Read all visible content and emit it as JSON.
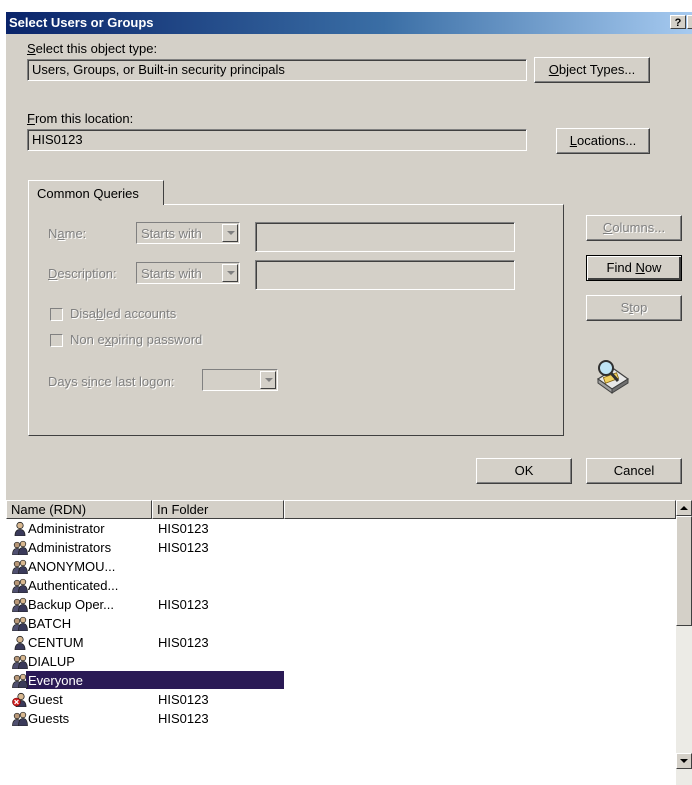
{
  "window": {
    "title": "Select Users or Groups",
    "help_glyph": "?",
    "close_glyph": "×"
  },
  "object_type": {
    "label_key": "S",
    "label_rest": "elect this object type:",
    "value": "Users, Groups, or Built-in security principals",
    "button_key": "O",
    "button_rest": "bject Types..."
  },
  "location": {
    "label_key": "F",
    "label_rest": "rom this location:",
    "value": "HIS0123",
    "button_key": "L",
    "button_rest": "ocations..."
  },
  "tab": {
    "label": "Common Queries"
  },
  "queries": {
    "name_label_a": "N",
    "name_label_key": "a",
    "name_label_b": "me:",
    "name_mode": "Starts with",
    "description_label_key": "D",
    "description_label_rest": "escription:",
    "description_mode": "Starts with",
    "disabled_a": "Disa",
    "disabled_key": "b",
    "disabled_b": "led accounts",
    "nonexpiring_a": "Non e",
    "nonexpiring_key": "x",
    "nonexpiring_b": "piring password",
    "days_a": "Days s",
    "days_key": "i",
    "days_b": "nce last logon:",
    "days_value": ""
  },
  "side_buttons": {
    "columns_key": "C",
    "columns_rest": "olumns...",
    "findnow_a": "Find ",
    "findnow_key": "N",
    "findnow_b": "ow",
    "stop_a": "S",
    "stop_key": "t",
    "stop_b": "op",
    "search_icon": "search-magnifier-icon"
  },
  "dialog_buttons": {
    "ok": "OK",
    "cancel": "Cancel"
  },
  "results": {
    "columns": [
      "Name (RDN)",
      "In Folder"
    ],
    "rows": [
      {
        "name": "Administrator",
        "folder": "HIS0123",
        "icon": "user"
      },
      {
        "name": "Administrators",
        "folder": "HIS0123",
        "icon": "group"
      },
      {
        "name": "ANONYMOU...",
        "folder": "",
        "icon": "group"
      },
      {
        "name": "Authenticated...",
        "folder": "",
        "icon": "group"
      },
      {
        "name": "Backup Oper...",
        "folder": "HIS0123",
        "icon": "group"
      },
      {
        "name": "BATCH",
        "folder": "",
        "icon": "group"
      },
      {
        "name": "CENTUM",
        "folder": "HIS0123",
        "icon": "user"
      },
      {
        "name": "DIALUP",
        "folder": "",
        "icon": "group"
      },
      {
        "name": "Everyone",
        "folder": "",
        "icon": "group",
        "selected": true
      },
      {
        "name": "Guest",
        "folder": "HIS0123",
        "icon": "user-disabled"
      },
      {
        "name": "Guests",
        "folder": "HIS0123",
        "icon": "group"
      }
    ]
  },
  "colors": {
    "selection": "#2a1a55",
    "face": "#d4d0c8",
    "title_start": "#0a246a",
    "title_end": "#a6caf0"
  }
}
